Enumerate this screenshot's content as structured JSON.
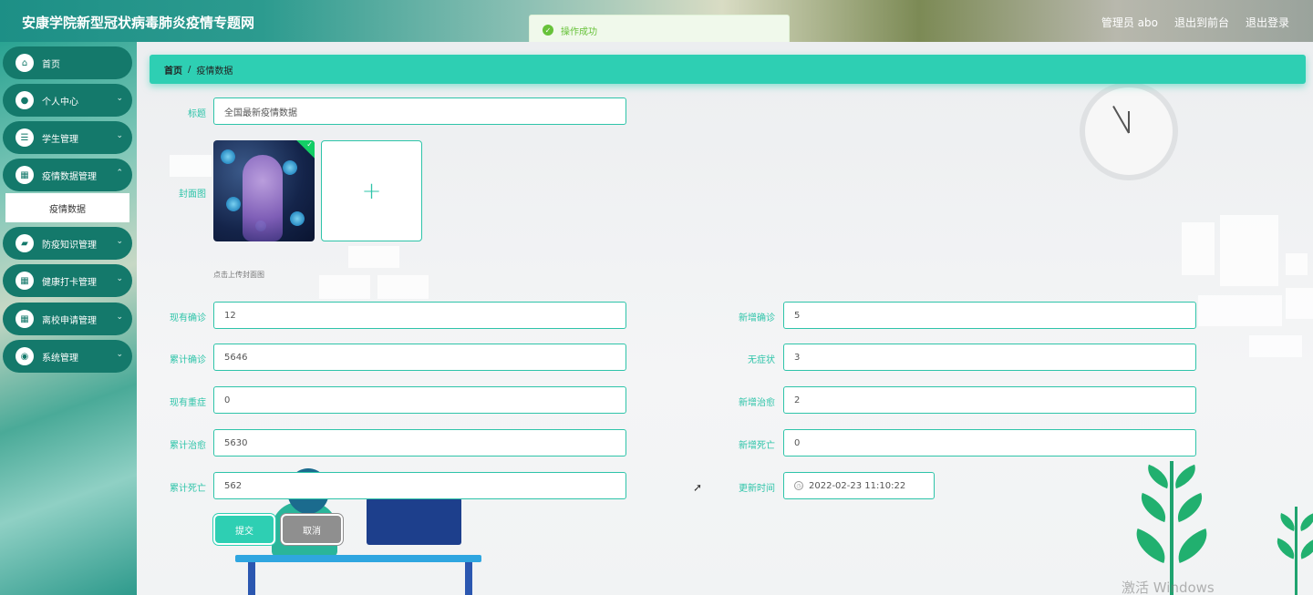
{
  "header": {
    "site_title": "安康学院新型冠状病毒肺炎疫情专题网",
    "user_label": "管理员 abo",
    "back_to_front": "退出到前台",
    "logout": "退出登录"
  },
  "toast": {
    "message": "操作成功",
    "icon": "check-circle-icon",
    "color": "#67c23a"
  },
  "sidebar": {
    "items": [
      {
        "label": "首页",
        "icon": "home-icon"
      },
      {
        "label": "个人中心",
        "icon": "user-icon"
      },
      {
        "label": "学生管理",
        "icon": "sliders-icon"
      },
      {
        "label": "疫情数据管理",
        "icon": "grid-icon"
      },
      {
        "label": "防疫知识管理",
        "icon": "wallet-icon"
      },
      {
        "label": "健康打卡管理",
        "icon": "grid-icon"
      },
      {
        "label": "离校申请管理",
        "icon": "grid-icon"
      },
      {
        "label": "系统管理",
        "icon": "pin-icon"
      }
    ],
    "active_sub_item": "疫情数据"
  },
  "breadcrumb": {
    "home": "首页",
    "separator": "/",
    "current": "疫情数据"
  },
  "form": {
    "title_label": "标题",
    "title_value": "全国最新疫情数据",
    "cover_label": "封面图",
    "upload_tip": "点击上传封面图",
    "upload_plus": "+",
    "fields_left": [
      {
        "label": "现有确诊",
        "value": "12"
      },
      {
        "label": "累计确诊",
        "value": "5646"
      },
      {
        "label": "现有重症",
        "value": "0"
      },
      {
        "label": "累计治愈",
        "value": "5630"
      },
      {
        "label": "累计死亡",
        "value": "562"
      }
    ],
    "fields_right": [
      {
        "label": "新增确诊",
        "value": "5"
      },
      {
        "label": "无症状",
        "value": "3"
      },
      {
        "label": "新增治愈",
        "value": "2"
      },
      {
        "label": "新增死亡",
        "value": "0"
      }
    ],
    "update_time_label": "更新时间",
    "update_time_value": "2022-02-23 11:10:22",
    "submit_label": "提交",
    "cancel_label": "取消"
  },
  "watermark": "激活 Windows",
  "colors": {
    "accent": "#2ecfb3",
    "sidebar_item": "#14796b",
    "cancel": "#8f8f8f"
  }
}
